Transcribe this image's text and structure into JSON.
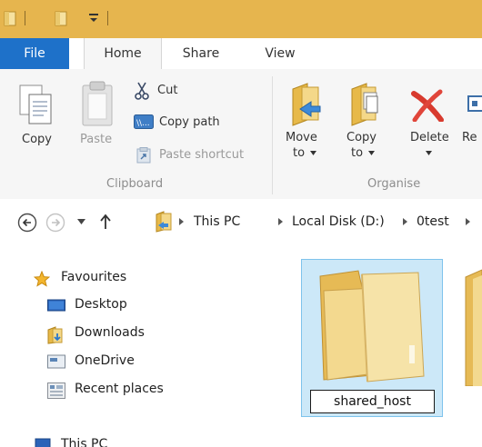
{
  "window": {
    "accent_color": "#e6b54e",
    "quick_access_icons": [
      "folder-icon",
      "folder-icon",
      "dropdown-arrow-icon"
    ]
  },
  "tabs": {
    "file": "File",
    "home": "Home",
    "share": "Share",
    "view": "View",
    "active": "Home",
    "file_color": "#1e71c9"
  },
  "ribbon": {
    "clipboard": {
      "copy": "Copy",
      "paste": "Paste",
      "cut": "Cut",
      "copy_path": "Copy path",
      "paste_shortcut": "Paste shortcut",
      "group_label": "Clipboard"
    },
    "organise": {
      "move_to_line1": "Move",
      "move_to_line2": "to",
      "copy_to_line1": "Copy",
      "copy_to_line2": "to",
      "delete": "Delete",
      "rename_partial": "Re",
      "group_label": "Organise"
    }
  },
  "address": {
    "crumbs": [
      "This PC",
      "Local Disk (D:)",
      "0test"
    ]
  },
  "navigation": {
    "favourites": "Favourites",
    "items": [
      "Desktop",
      "Downloads",
      "OneDrive",
      "Recent places"
    ],
    "this_pc": "This PC"
  },
  "content": {
    "selected_item_name": "shared_host",
    "selection_color": "#cce8f8"
  }
}
